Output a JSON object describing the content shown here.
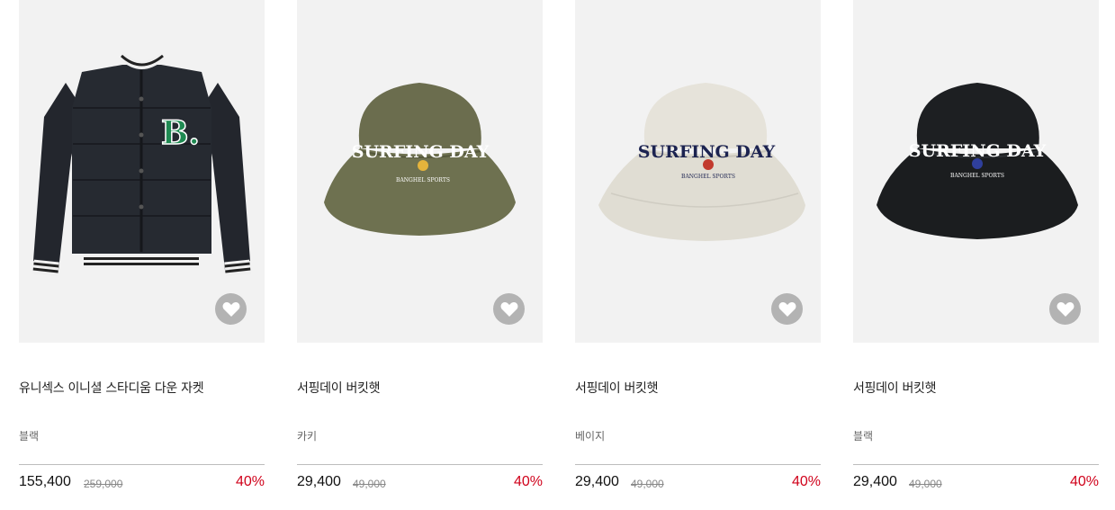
{
  "products": [
    {
      "name": "유니섹스 이니셜 스타디움 다운 자켓",
      "color": "블랙",
      "price": "155,400",
      "original_price": "259,000",
      "discount": "40%",
      "image_kind": "jacket",
      "image_color": "#23262d"
    },
    {
      "name": "서핑데이 버킷햇",
      "color": "카키",
      "price": "29,400",
      "original_price": "49,000",
      "discount": "40%",
      "image_kind": "bucket-hat",
      "image_color": "#6b6d4e"
    },
    {
      "name": "서핑데이 버킷햇",
      "color": "베이지",
      "price": "29,400",
      "original_price": "49,000",
      "discount": "40%",
      "image_kind": "bucket-hat",
      "image_color": "#e3e0d6"
    },
    {
      "name": "서핑데이 버킷햇",
      "color": "블랙",
      "price": "29,400",
      "original_price": "49,000",
      "discount": "40%",
      "image_kind": "bucket-hat",
      "image_color": "#1b1d1f"
    }
  ],
  "hat_print": {
    "line1": "SURFING DAY",
    "line2": "BANGHEL SPORTS"
  },
  "jacket_print": "B.",
  "colors": {
    "discount": "#d0021b",
    "thumb_bg": "#f2f2f2",
    "wish_button": "#b3b3b3"
  },
  "icons": {
    "wish": "heart-icon"
  }
}
